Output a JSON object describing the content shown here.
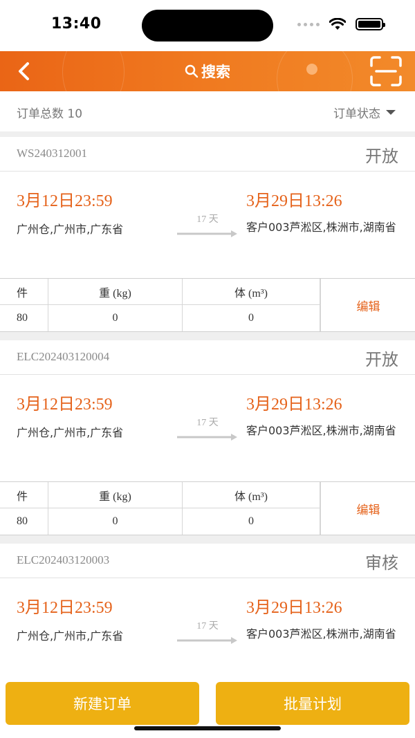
{
  "status_bar": {
    "time": "13:40"
  },
  "nav": {
    "title": "搜索"
  },
  "summary": {
    "count_label": "订单总数 10",
    "filter_label": "订单状态"
  },
  "orders": [
    {
      "order_no": "WS240312001",
      "status": "开放",
      "from_time": "3月12日23:59",
      "from_addr": "广州仓,广州市,广东省",
      "duration": "17 天",
      "to_time": "3月29日13:26",
      "to_addr": "客户003芦淞区,株洲市,湖南省",
      "stats_headers": [
        "件",
        "重 (kg)",
        "体 (m³)"
      ],
      "stats_values": [
        "80",
        "0",
        "0"
      ],
      "edit_label": "编辑"
    },
    {
      "order_no": "ELC202403120004",
      "status": "开放",
      "from_time": "3月12日23:59",
      "from_addr": "广州仓,广州市,广东省",
      "duration": "17 天",
      "to_time": "3月29日13:26",
      "to_addr": "客户003芦淞区,株洲市,湖南省",
      "stats_headers": [
        "件",
        "重 (kg)",
        "体 (m³)"
      ],
      "stats_values": [
        "80",
        "0",
        "0"
      ],
      "edit_label": "编辑"
    },
    {
      "order_no": "ELC202403120003",
      "status": "审核",
      "from_time": "3月12日23:59",
      "from_addr": "广州仓,广州市,广东省",
      "duration": "17 天",
      "to_time": "3月29日13:26",
      "to_addr": "客户003芦淞区,株洲市,湖南省"
    }
  ],
  "actions": {
    "new_order": "新建订单",
    "batch_plan": "批量计划"
  },
  "colors": {
    "accent": "#e5621a",
    "nav_bg": "#ea6516",
    "button_bg": "#eeb012"
  }
}
